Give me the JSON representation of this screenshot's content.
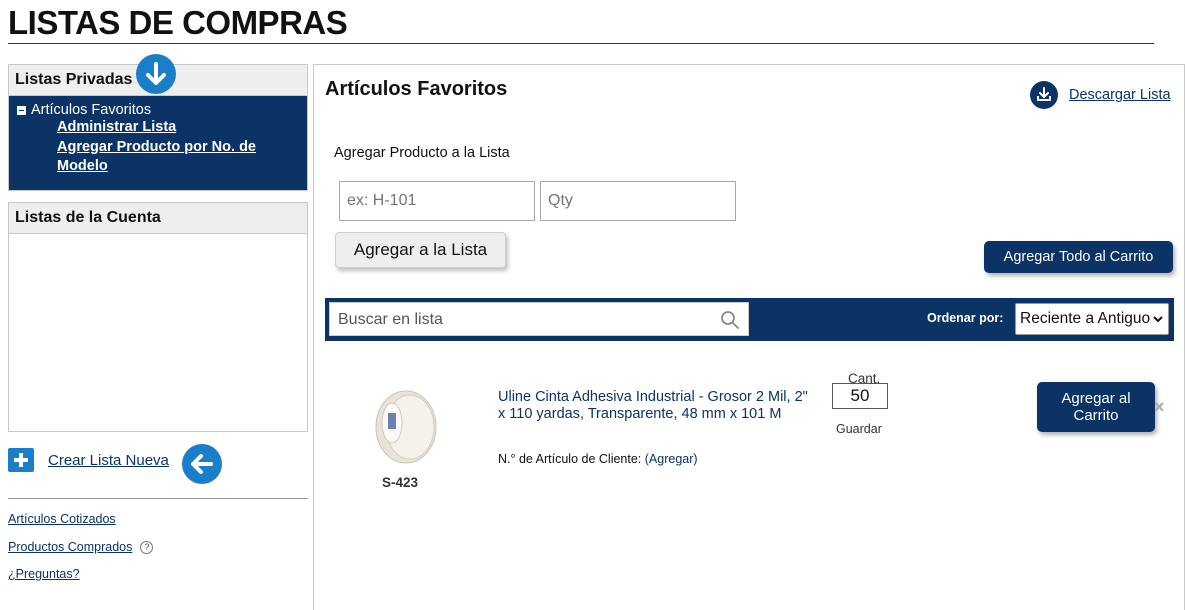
{
  "header": {
    "title": "LISTAS DE COMPRAS"
  },
  "sidebar": {
    "private_lists": {
      "title": "Listas Privadas",
      "active_list": "Artículos Favoritos",
      "sub_items": [
        "Administrar Lista",
        "Agregar Producto por No. de Modelo"
      ]
    },
    "account_lists": {
      "title": "Listas de la Cuenta"
    },
    "create_new": "Crear Lista Nueva",
    "links": [
      "Artículos Cotizados",
      "Productos Comprados",
      "¿Preguntas?"
    ],
    "help_glyph": "?"
  },
  "main": {
    "title": "Artículos Favoritos",
    "download_label": "Descargar Lista",
    "add_section_label": "Agregar Producto a la Lista",
    "model_placeholder": "ex: H-101",
    "qty_placeholder": "Qty",
    "add_button": "Agregar a la Lista",
    "add_all_button": "Agregar Todo al Carrito",
    "search_placeholder": "Buscar en lista",
    "sort_label": "Ordenar por:",
    "sort_selected": "Reciente a Antiguo"
  },
  "items": [
    {
      "sku": "S-423",
      "name": "Uline Cinta Adhesiva Industrial - Grosor 2 Mil, 2\" x 110 yardas, Transparente, 48 mm x 101 M",
      "customer_label": "N.° de Artículo de Cliente:",
      "customer_action": "(Agregar)",
      "qty_label": "Cant.",
      "qty": "50",
      "save_label": "Guardar",
      "cart_button": "Agregar al Carrito",
      "remove_glyph": "×"
    }
  ],
  "colors": {
    "navy": "#0b3365",
    "accent_blue": "#1a7ec9",
    "panel_gray": "#eeeeee"
  },
  "icons": [
    "arrow-down-circle-icon",
    "arrow-left-circle-icon",
    "plus-square-icon",
    "download-icon",
    "search-icon",
    "chevron-down-icon",
    "close-icon",
    "minus-box-icon"
  ]
}
